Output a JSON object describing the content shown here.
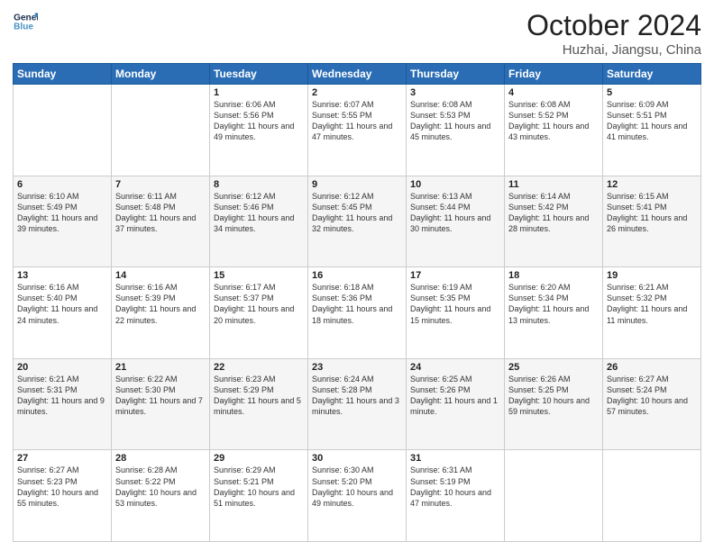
{
  "header": {
    "logo_general": "General",
    "logo_blue": "Blue",
    "month": "October 2024",
    "location": "Huzhai, Jiangsu, China"
  },
  "weekdays": [
    "Sunday",
    "Monday",
    "Tuesday",
    "Wednesday",
    "Thursday",
    "Friday",
    "Saturday"
  ],
  "weeks": [
    [
      null,
      null,
      {
        "day": 1,
        "sunrise": "6:06 AM",
        "sunset": "5:56 PM",
        "daylight": "11 hours and 49 minutes."
      },
      {
        "day": 2,
        "sunrise": "6:07 AM",
        "sunset": "5:55 PM",
        "daylight": "11 hours and 47 minutes."
      },
      {
        "day": 3,
        "sunrise": "6:08 AM",
        "sunset": "5:53 PM",
        "daylight": "11 hours and 45 minutes."
      },
      {
        "day": 4,
        "sunrise": "6:08 AM",
        "sunset": "5:52 PM",
        "daylight": "11 hours and 43 minutes."
      },
      {
        "day": 5,
        "sunrise": "6:09 AM",
        "sunset": "5:51 PM",
        "daylight": "11 hours and 41 minutes."
      }
    ],
    [
      {
        "day": 6,
        "sunrise": "6:10 AM",
        "sunset": "5:49 PM",
        "daylight": "11 hours and 39 minutes."
      },
      {
        "day": 7,
        "sunrise": "6:11 AM",
        "sunset": "5:48 PM",
        "daylight": "11 hours and 37 minutes."
      },
      {
        "day": 8,
        "sunrise": "6:12 AM",
        "sunset": "5:46 PM",
        "daylight": "11 hours and 34 minutes."
      },
      {
        "day": 9,
        "sunrise": "6:12 AM",
        "sunset": "5:45 PM",
        "daylight": "11 hours and 32 minutes."
      },
      {
        "day": 10,
        "sunrise": "6:13 AM",
        "sunset": "5:44 PM",
        "daylight": "11 hours and 30 minutes."
      },
      {
        "day": 11,
        "sunrise": "6:14 AM",
        "sunset": "5:42 PM",
        "daylight": "11 hours and 28 minutes."
      },
      {
        "day": 12,
        "sunrise": "6:15 AM",
        "sunset": "5:41 PM",
        "daylight": "11 hours and 26 minutes."
      }
    ],
    [
      {
        "day": 13,
        "sunrise": "6:16 AM",
        "sunset": "5:40 PM",
        "daylight": "11 hours and 24 minutes."
      },
      {
        "day": 14,
        "sunrise": "6:16 AM",
        "sunset": "5:39 PM",
        "daylight": "11 hours and 22 minutes."
      },
      {
        "day": 15,
        "sunrise": "6:17 AM",
        "sunset": "5:37 PM",
        "daylight": "11 hours and 20 minutes."
      },
      {
        "day": 16,
        "sunrise": "6:18 AM",
        "sunset": "5:36 PM",
        "daylight": "11 hours and 18 minutes."
      },
      {
        "day": 17,
        "sunrise": "6:19 AM",
        "sunset": "5:35 PM",
        "daylight": "11 hours and 15 minutes."
      },
      {
        "day": 18,
        "sunrise": "6:20 AM",
        "sunset": "5:34 PM",
        "daylight": "11 hours and 13 minutes."
      },
      {
        "day": 19,
        "sunrise": "6:21 AM",
        "sunset": "5:32 PM",
        "daylight": "11 hours and 11 minutes."
      }
    ],
    [
      {
        "day": 20,
        "sunrise": "6:21 AM",
        "sunset": "5:31 PM",
        "daylight": "11 hours and 9 minutes."
      },
      {
        "day": 21,
        "sunrise": "6:22 AM",
        "sunset": "5:30 PM",
        "daylight": "11 hours and 7 minutes."
      },
      {
        "day": 22,
        "sunrise": "6:23 AM",
        "sunset": "5:29 PM",
        "daylight": "11 hours and 5 minutes."
      },
      {
        "day": 23,
        "sunrise": "6:24 AM",
        "sunset": "5:28 PM",
        "daylight": "11 hours and 3 minutes."
      },
      {
        "day": 24,
        "sunrise": "6:25 AM",
        "sunset": "5:26 PM",
        "daylight": "11 hours and 1 minute."
      },
      {
        "day": 25,
        "sunrise": "6:26 AM",
        "sunset": "5:25 PM",
        "daylight": "10 hours and 59 minutes."
      },
      {
        "day": 26,
        "sunrise": "6:27 AM",
        "sunset": "5:24 PM",
        "daylight": "10 hours and 57 minutes."
      }
    ],
    [
      {
        "day": 27,
        "sunrise": "6:27 AM",
        "sunset": "5:23 PM",
        "daylight": "10 hours and 55 minutes."
      },
      {
        "day": 28,
        "sunrise": "6:28 AM",
        "sunset": "5:22 PM",
        "daylight": "10 hours and 53 minutes."
      },
      {
        "day": 29,
        "sunrise": "6:29 AM",
        "sunset": "5:21 PM",
        "daylight": "10 hours and 51 minutes."
      },
      {
        "day": 30,
        "sunrise": "6:30 AM",
        "sunset": "5:20 PM",
        "daylight": "10 hours and 49 minutes."
      },
      {
        "day": 31,
        "sunrise": "6:31 AM",
        "sunset": "5:19 PM",
        "daylight": "10 hours and 47 minutes."
      },
      null,
      null
    ]
  ]
}
